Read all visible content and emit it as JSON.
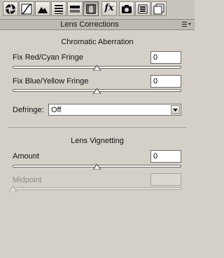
{
  "toolbar": {
    "tabs": [
      {
        "icon": "aperture-icon"
      },
      {
        "icon": "tone-curve-icon"
      },
      {
        "icon": "mountain-detail-icon"
      },
      {
        "icon": "hsl-grayscale-icon"
      },
      {
        "icon": "split-toning-icon"
      },
      {
        "icon": "lens-corrections-icon",
        "active": true
      },
      {
        "icon": "fx-effects-icon",
        "text": "fx"
      },
      {
        "icon": "camera-calibration-icon"
      },
      {
        "icon": "presets-icon"
      },
      {
        "icon": "snapshots-icon"
      }
    ]
  },
  "panel": {
    "title": "Lens Corrections",
    "menu_icon": "panel-menu-icon"
  },
  "chromatic_aberration": {
    "title": "Chromatic Aberration",
    "red_cyan": {
      "label": "Fix Red/Cyan Fringe",
      "value": "0",
      "slider_level": 0.5
    },
    "blue_yellow": {
      "label": "Fix Blue/Yellow Fringe",
      "value": "0",
      "slider_level": 0.5
    },
    "defringe": {
      "label": "Defringe:",
      "selected": "Off"
    }
  },
  "vignetting": {
    "title": "Lens Vignetting",
    "amount": {
      "label": "Amount",
      "value": "0",
      "slider_level": 0.5
    },
    "midpoint": {
      "label": "Midpoint",
      "value": "",
      "slider_level": 0.0,
      "disabled": true
    }
  }
}
